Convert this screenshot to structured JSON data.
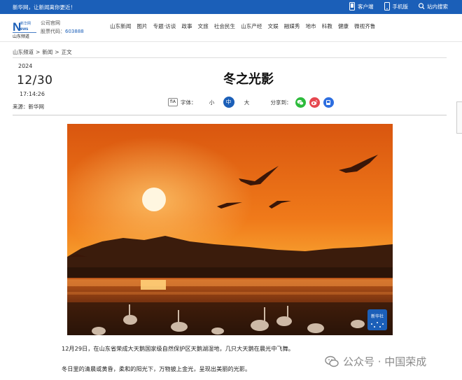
{
  "topbar": {
    "slogan": "新华网，让新闻离你更近！",
    "tools": [
      {
        "label": "客户端",
        "icon": "phone-icon"
      },
      {
        "label": "手机版",
        "icon": "mobile-icon"
      },
      {
        "label": "站内搜索",
        "icon": "search-icon"
      }
    ]
  },
  "header": {
    "logo_line1": "新华网",
    "logo_line2": "山东频道",
    "company_label": "公司官网",
    "stock_label": "股票代码：",
    "stock_code": "603888",
    "nav": [
      "山东新闻",
      "图片",
      "专题·访谈",
      "政事",
      "文旅",
      "社会民生",
      "山东产经",
      "文娱",
      "融媒秀",
      "地市",
      "科教",
      "健康",
      "微视齐鲁"
    ]
  },
  "breadcrumb": [
    "山东频道",
    "新闻",
    "正文"
  ],
  "article": {
    "year": "2024",
    "date": "12/30",
    "time": "17:14:26",
    "source": "来源：新华网",
    "title": "冬之光影",
    "font_label": "字体：",
    "font_icon_text": "fiA",
    "font_options": [
      "小",
      "中",
      "大"
    ],
    "share_label": "分享到：",
    "share_icons": [
      "wechat-icon",
      "weibo-icon",
      "qzone-icon"
    ],
    "photo_badge": "新华社",
    "caption": "12月29日，在山东省荣成大天鹅国家级自然保护区天鹅湖湿地，几只大天鹅在晨光中飞舞。",
    "paragraph2": "冬日里的清晨或黄昏，柔和的阳光下，万物披上金光，呈现出美丽的光影。"
  },
  "watermark": "公众号 · 中国荣成",
  "colors": {
    "brand": "#1b5fb8",
    "wechat": "#2dbb3c",
    "weibo": "#e6474f",
    "qzone": "#2d6ee0"
  }
}
